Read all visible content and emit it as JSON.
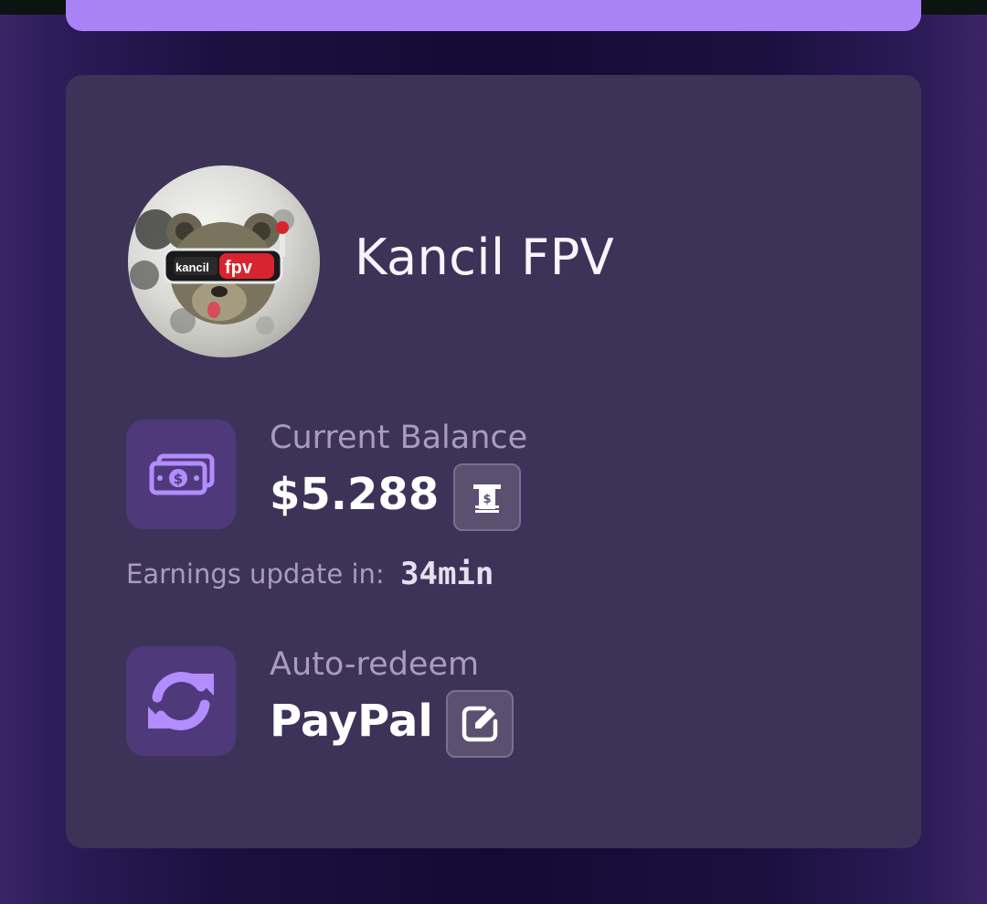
{
  "profile": {
    "name": "Kancil FPV",
    "avatar_logo_text": "kancil fpv"
  },
  "balance": {
    "label": "Current Balance",
    "value": "$5.288",
    "icon": "money-icon",
    "action_icon": "atm-withdraw-icon"
  },
  "earnings": {
    "label": "Earnings update in:",
    "value": "34min"
  },
  "auto_redeem": {
    "label": "Auto-redeem",
    "value": "PayPal",
    "icon": "refresh-icon",
    "action_icon": "edit-icon"
  },
  "colors": {
    "accent": "#a982f5",
    "card": "#3d3358",
    "icon_tile": "#4e3a7a",
    "text_primary": "#ffffff",
    "text_secondary": "#a99cc0"
  }
}
